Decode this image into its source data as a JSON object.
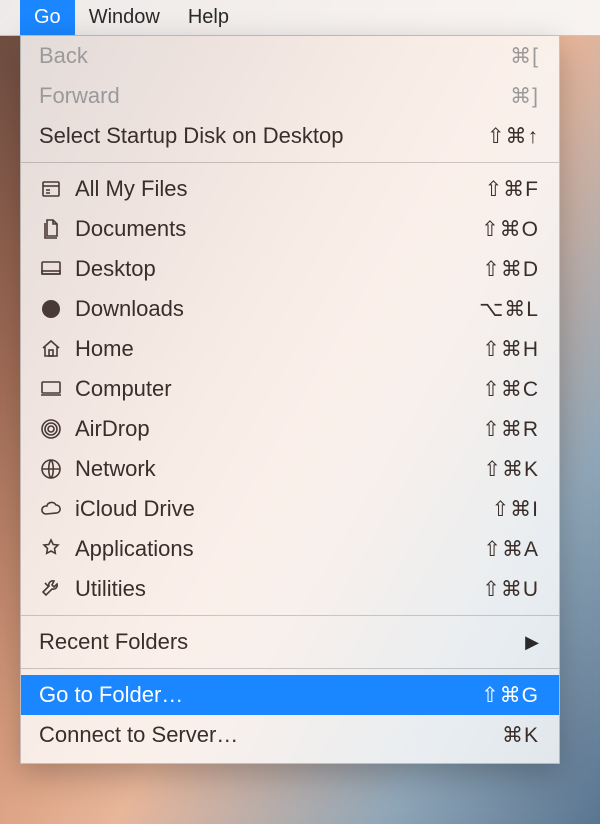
{
  "menubar": {
    "go": "Go",
    "window": "Window",
    "help": "Help"
  },
  "menu": {
    "back": {
      "label": "Back",
      "shortcut": "⌘["
    },
    "forward": {
      "label": "Forward",
      "shortcut": "⌘]"
    },
    "startup": {
      "label": "Select Startup Disk on Desktop",
      "shortcut": "⇧⌘↑"
    },
    "allfiles": {
      "label": "All My Files",
      "shortcut": "⇧⌘F"
    },
    "documents": {
      "label": "Documents",
      "shortcut": "⇧⌘O"
    },
    "desktop": {
      "label": "Desktop",
      "shortcut": "⇧⌘D"
    },
    "downloads": {
      "label": "Downloads",
      "shortcut": "⌥⌘L"
    },
    "home": {
      "label": "Home",
      "shortcut": "⇧⌘H"
    },
    "computer": {
      "label": "Computer",
      "shortcut": "⇧⌘C"
    },
    "airdrop": {
      "label": "AirDrop",
      "shortcut": "⇧⌘R"
    },
    "network": {
      "label": "Network",
      "shortcut": "⇧⌘K"
    },
    "icloud": {
      "label": "iCloud Drive",
      "shortcut": "⇧⌘I"
    },
    "apps": {
      "label": "Applications",
      "shortcut": "⇧⌘A"
    },
    "utilities": {
      "label": "Utilities",
      "shortcut": "⇧⌘U"
    },
    "recent": {
      "label": "Recent Folders"
    },
    "gofolder": {
      "label": "Go to Folder…",
      "shortcut": "⇧⌘G"
    },
    "connect": {
      "label": "Connect to Server…",
      "shortcut": "⌘K"
    }
  }
}
